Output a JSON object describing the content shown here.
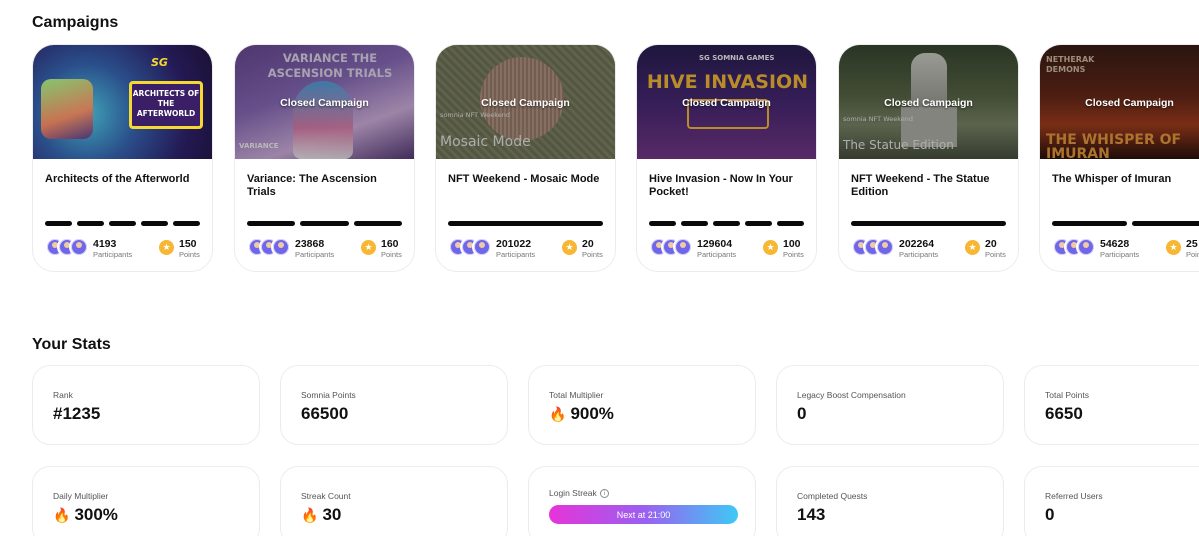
{
  "campaigns": {
    "title": "Campaigns",
    "closed_label": "Closed Campaign",
    "participants_label": "Participants",
    "points_label": "Points",
    "items": [
      {
        "title": "Architects of the Afterworld",
        "art_text": "ARCHITECTS OF THE AFTERWORLD",
        "art_brand": "SG",
        "closed": false,
        "progress": [
          1,
          1,
          1,
          1,
          1
        ],
        "participants": "4193",
        "points": "150"
      },
      {
        "title": "Variance: The Ascension Trials",
        "art_text": "VARIANCE THE ASCENSION TRIALS",
        "art_brand": "VARIANCE",
        "closed": true,
        "progress": [
          1,
          1,
          1
        ],
        "participants": "23868",
        "points": "160"
      },
      {
        "title": "NFT Weekend - Mosaic Mode",
        "art_text": "Mosaic Mode",
        "art_brand": "somnia NFT Weekend",
        "closed": true,
        "progress": [
          1
        ],
        "participants": "201022",
        "points": "20"
      },
      {
        "title": "Hive Invasion - Now In Your Pocket!",
        "art_text": "HIVE INVASION",
        "art_brand": "SG SOMNIA GAMES",
        "closed": true,
        "progress": [
          1,
          1,
          1,
          1,
          1
        ],
        "participants": "129604",
        "points": "100"
      },
      {
        "title": "NFT Weekend - The Statue Edition",
        "art_text": "The Statue Edition",
        "art_brand": "somnia NFT Weekend",
        "closed": true,
        "progress": [
          1
        ],
        "participants": "202264",
        "points": "20"
      },
      {
        "title": "The Whisper of Imuran",
        "art_text": "THE WHISPER OF IMURAN",
        "art_brand": "NETHERAK DEMONS",
        "closed": true,
        "progress": [
          1,
          1
        ],
        "participants": "54628",
        "points": "25"
      }
    ]
  },
  "stats": {
    "title": "Your Stats",
    "rank": {
      "label": "Rank",
      "value": "#1235"
    },
    "somnia_points": {
      "label": "Somnia Points",
      "value": "66500"
    },
    "total_multiplier": {
      "label": "Total Multiplier",
      "value": "900%"
    },
    "legacy_boost": {
      "label": "Legacy Boost Compensation",
      "value": "0"
    },
    "total_points": {
      "label": "Total Points",
      "value": "6650"
    },
    "daily_multiplier": {
      "label": "Daily Multiplier",
      "value": "300%"
    },
    "streak_count": {
      "label": "Streak Count",
      "value": "30"
    },
    "login_streak": {
      "label": "Login Streak",
      "button": "Next at 21:00"
    },
    "completed_quests": {
      "label": "Completed Quests",
      "value": "143"
    },
    "referred_users": {
      "label": "Referred Users",
      "value": "0"
    }
  },
  "colors": {
    "accent_gradient_start": "#e634d8",
    "accent_gradient_end": "#3ec9f5",
    "coin": "#f7b733",
    "avatar": "#6f66e8"
  },
  "icons": {
    "fire": "fire-icon",
    "coin": "star-coin-icon",
    "info": "info-icon"
  }
}
